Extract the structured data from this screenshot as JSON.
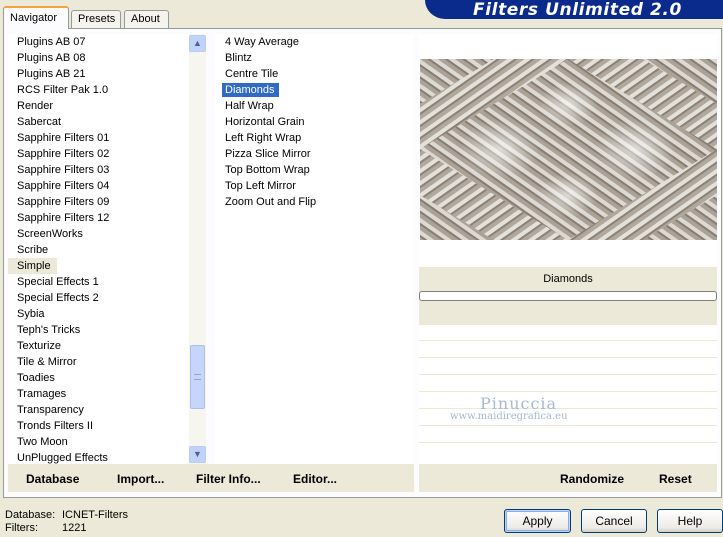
{
  "banner": {
    "title": "Filters Unlimited 2.0"
  },
  "tabs": [
    {
      "label": "Navigator",
      "active": true
    },
    {
      "label": "Presets",
      "active": false
    },
    {
      "label": "About",
      "active": false
    }
  ],
  "categories": [
    "Plugins AB 07",
    "Plugins AB 08",
    "Plugins AB 21",
    "RCS Filter Pak 1.0",
    "Render",
    "Sabercat",
    "Sapphire Filters 01",
    "Sapphire Filters 02",
    "Sapphire Filters 03",
    "Sapphire Filters 04",
    "Sapphire Filters 09",
    "Sapphire Filters 12",
    "ScreenWorks",
    "Scribe",
    "Simple",
    "Special Effects 1",
    "Special Effects 2",
    "Sybia",
    "Teph's Tricks",
    "Texturize",
    "Tile & Mirror",
    "Toadies",
    "Tramages",
    "Transparency",
    "Tronds Filters II",
    "Two Moon",
    "UnPlugged Effects"
  ],
  "selected_category": "Simple",
  "filters": [
    "4 Way Average",
    "Blintz",
    "Centre Tile",
    "Diamonds",
    "Half Wrap",
    "Horizontal Grain",
    "Left Right Wrap",
    "Pizza Slice Mirror",
    "Top Bottom Wrap",
    "Top Left Mirror",
    "Zoom Out and Flip"
  ],
  "selected_filter": "Diamonds",
  "preview": {
    "filter_name": "Diamonds"
  },
  "watermark": {
    "name": "Pinuccia",
    "url": "www.maidiregrafica.eu"
  },
  "left_toolbar": {
    "database": "Database",
    "import": "Import...",
    "filter_info": "Filter Info...",
    "editor": "Editor..."
  },
  "right_toolbar": {
    "randomize": "Randomize",
    "reset": "Reset"
  },
  "status": {
    "database_label": "Database:",
    "database_value": "ICNET-Filters",
    "filters_label": "Filters:",
    "filters_value": "1221"
  },
  "buttons": {
    "apply": "Apply",
    "cancel": "Cancel",
    "help": "Help"
  },
  "icons": {
    "scroll_up": "chevron-up-icon",
    "scroll_down": "chevron-down-icon"
  },
  "colors": {
    "banner": "#0a2a8c",
    "selection": "#316ac5",
    "face": "#ece9d8"
  }
}
